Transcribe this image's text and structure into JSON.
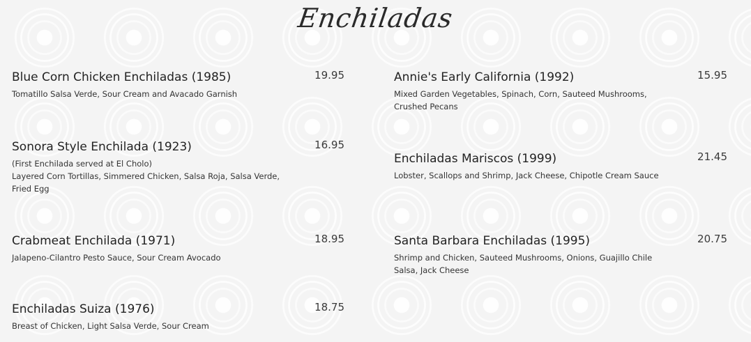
{
  "title": "Enchiladas",
  "items": [
    {
      "name": "Blue Corn Chicken Enchiladas (1985)",
      "price": "19.95",
      "desc": [
        "Tomatillo Salsa Verde, Sour Cream and Avacado Garnish"
      ]
    },
    {
      "name": "Sonora Style Enchilada (1923)",
      "price": "16.95",
      "desc": [
        "(First Enchilada served at El Cholo)",
        "Layered Corn Tortillas, Simmered Chicken, Salsa Roja, Salsa Verde, Fried Egg"
      ]
    },
    {
      "name": "Crabmeat Enchilada (1971)",
      "price": "18.95",
      "desc": [
        "Jalapeno-Cilantro Pesto Sauce, Sour Cream Avocado"
      ]
    },
    {
      "name": "Enchiladas Suiza (1976)",
      "price": "18.75",
      "desc": [
        "Breast of Chicken, Light Salsa Verde, Sour Cream"
      ]
    },
    {
      "name": "Annie's Early California (1992)",
      "price": "15.95",
      "desc": [
        "Mixed Garden Vegetables, Spinach, Corn, Sauteed Mushrooms, Crushed Pecans"
      ]
    },
    {
      "name": "Enchiladas Mariscos (1999)",
      "price": "21.45",
      "desc": [
        "Lobster, Scallops and Shrimp, Jack Cheese, Chipotle Cream Sauce"
      ]
    },
    {
      "name": "Santa Barbara Enchiladas (1995)",
      "price": "20.75",
      "desc": [
        "Shrimp and Chicken, Sauteed Mushrooms, Onions, Guajillo Chile Salsa, Jack Cheese"
      ]
    }
  ]
}
